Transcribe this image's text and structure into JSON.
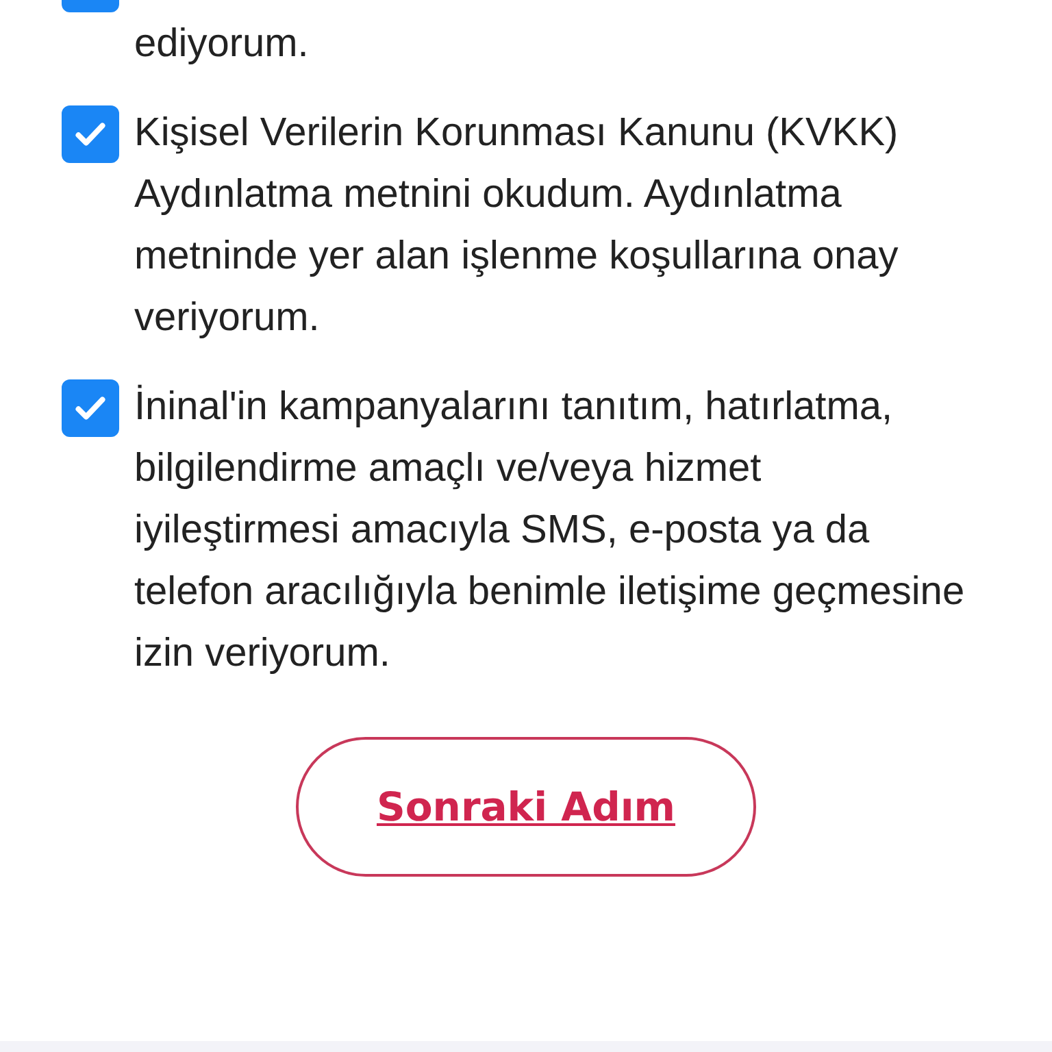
{
  "consents": [
    {
      "text": "ediyorum.",
      "checked": true
    },
    {
      "text": "Kişisel Verilerin Korunması Kanunu (KVKK) Aydınlatma metnini okudum. Aydınlatma metninde yer alan işlenme koşullarına onay veriyorum.",
      "checked": true
    },
    {
      "text": "İninal'in kampanyalarını tanıtım, hatırlatma, bilgilendirme amaçlı ve/veya hizmet iyileştirmesi amacıyla SMS, e-posta ya da telefon aracılığıyla benimle iletişime geçmesine izin veriyorum.",
      "checked": true
    }
  ],
  "next_button": "Sonraki Adım"
}
